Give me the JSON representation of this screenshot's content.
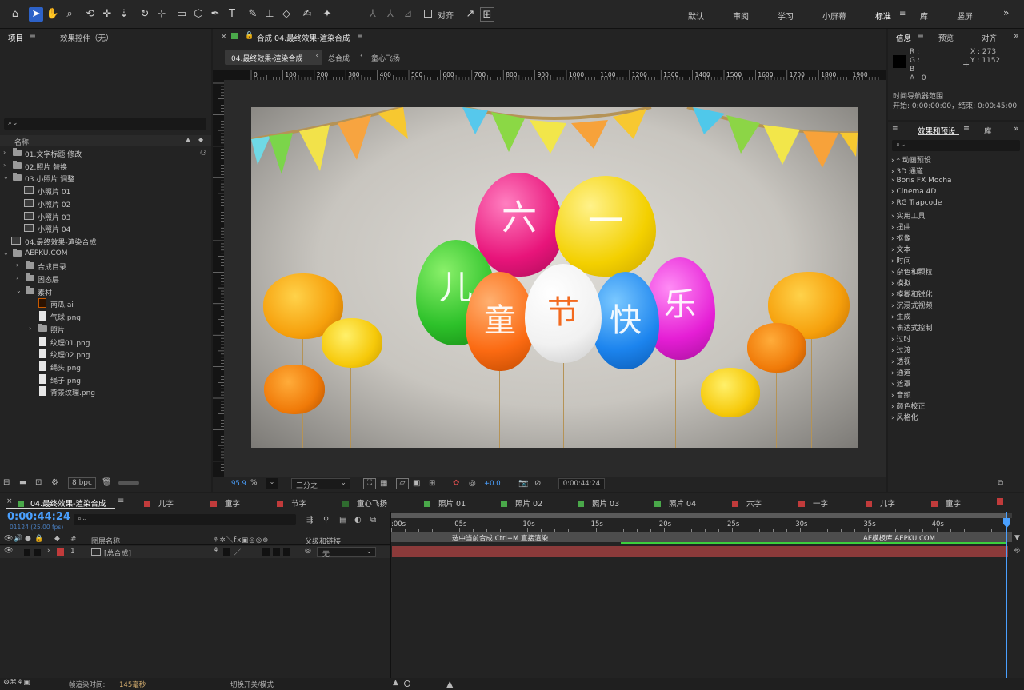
{
  "workspaces": [
    "默认",
    "审阅",
    "学习",
    "小屏幕",
    "标准",
    "库",
    "竖屏"
  ],
  "toolbar": {
    "align_label": "对齐"
  },
  "project_panel": {
    "tab_project": "项目",
    "tab_effects": "效果控件（无）",
    "search_placeholder": "",
    "col_name": "名称",
    "items": [
      {
        "label": "01.文字标题 修改",
        "level": 0,
        "type": "folder",
        "expanded": false
      },
      {
        "label": "02.照片 替换",
        "level": 0,
        "type": "folder",
        "expanded": false
      },
      {
        "label": "03.小照片 调整",
        "level": 0,
        "type": "folder",
        "expanded": true
      },
      {
        "label": "小照片 01",
        "level": 1,
        "type": "comp"
      },
      {
        "label": "小照片 02",
        "level": 1,
        "type": "comp"
      },
      {
        "label": "小照片 03",
        "level": 1,
        "type": "comp"
      },
      {
        "label": "小照片 04",
        "level": 1,
        "type": "comp"
      },
      {
        "label": "04.最终效果-渲染合成",
        "level": 0,
        "type": "comp"
      },
      {
        "label": "AEPKU.COM",
        "level": 0,
        "type": "folder",
        "expanded": true
      },
      {
        "label": "合成目录",
        "level": 1,
        "type": "folder",
        "expanded": false
      },
      {
        "label": "固态层",
        "level": 1,
        "type": "folder",
        "expanded": false
      },
      {
        "label": "素材",
        "level": 1,
        "type": "folder",
        "expanded": true
      },
      {
        "label": "南瓜.ai",
        "level": 2,
        "type": "ai"
      },
      {
        "label": "气球.png",
        "level": 2,
        "type": "file"
      },
      {
        "label": "照片",
        "level": 2,
        "type": "folder",
        "expanded": false
      },
      {
        "label": "纹理01.png",
        "level": 2,
        "type": "file"
      },
      {
        "label": "纹理02.png",
        "level": 2,
        "type": "file"
      },
      {
        "label": "绳头.png",
        "level": 2,
        "type": "file"
      },
      {
        "label": "绳子.png",
        "level": 2,
        "type": "file"
      },
      {
        "label": "背景纹理.png",
        "level": 2,
        "type": "file"
      }
    ],
    "bpc": "8 bpc"
  },
  "composition": {
    "header": "合成 04.最终效果-渲染合成",
    "breadcrumbs": [
      "04.最终效果-渲染合成",
      "总合成",
      "童心飞扬"
    ],
    "ruler_labels": [
      "0",
      "100",
      "200",
      "300",
      "400",
      "500",
      "600",
      "700",
      "800",
      "900",
      "1000",
      "1100",
      "1200",
      "1300",
      "1400",
      "1500",
      "1600",
      "1700",
      "1800",
      "1900"
    ],
    "zoom_value": "95.9",
    "zoom_unit": "%",
    "resolution": "三分之一",
    "exposure": "+0.0",
    "timecode": "0:00:44:24",
    "balloon_chars": [
      "六",
      "一",
      "儿",
      "童",
      "节",
      "快",
      "乐"
    ]
  },
  "info_panel": {
    "tabs": [
      "信息",
      "预览",
      "对齐"
    ],
    "r": "R :",
    "g": "G :",
    "b": "B :",
    "a": "A : 0",
    "x": "X : 273",
    "y": "Y : 1152",
    "nav_title": "时间导航器范围",
    "nav_range": "开始: 0:00:00:00，结束: 0:00:45:00"
  },
  "effects_panel": {
    "tab": "效果和预设",
    "tab_lib": "库",
    "items": [
      "* 动画预设",
      "3D 通道",
      "Boris FX Mocha",
      "Cinema 4D",
      "RG Trapcode",
      "实用工具",
      "扭曲",
      "抠像",
      "文本",
      "时间",
      "杂色和颗粒",
      "模拟",
      "模糊和锐化",
      "沉浸式视频",
      "生成",
      "表达式控制",
      "过时",
      "过渡",
      "透视",
      "通道",
      "遮罩",
      "音频",
      "颜色校正",
      "风格化"
    ]
  },
  "timeline": {
    "tabs": [
      {
        "label": "04.最终效果-渲染合成",
        "color": "#4aa84a"
      },
      {
        "label": "儿字",
        "color": "#c13b3b"
      },
      {
        "label": "童字",
        "color": "#c13b3b"
      },
      {
        "label": "节字",
        "color": "#c13b3b"
      },
      {
        "label": "童心飞扬",
        "color": "#2f6b2f"
      },
      {
        "label": "照片 01",
        "color": "#4aa84a"
      },
      {
        "label": "照片 02",
        "color": "#4aa84a"
      },
      {
        "label": "照片 03",
        "color": "#4aa84a"
      },
      {
        "label": "照片 04",
        "color": "#4aa84a"
      },
      {
        "label": "六字",
        "color": "#c13b3b"
      },
      {
        "label": "一字",
        "color": "#c13b3b"
      },
      {
        "label": "儿字",
        "color": "#c13b3b"
      },
      {
        "label": "童字",
        "color": "#c13b3b"
      }
    ],
    "timecode": "0:00:44:24",
    "frames": "01124 (25.00 fps)",
    "col_layer_name": "图层名称",
    "col_parent": "父级和链接",
    "col_num": "#",
    "layer": {
      "num": "1",
      "name": "[总合成]",
      "parent": "无"
    },
    "ruler_labels": [
      ":00s",
      "05s",
      "10s",
      "15s",
      "20s",
      "25s",
      "30s",
      "35s",
      "40s"
    ],
    "marker_1": "选中当前合成 Ctrl+M 直接渲染",
    "marker_2": "AE模板库 AEPKU.COM",
    "footer_label": "帧渲染时间:",
    "footer_value": "145毫秒",
    "footer_toggle": "切换开关/模式"
  },
  "colors": {
    "accent": "#2d62c8",
    "time_blue": "#4aa0ff",
    "layer_bar": "#8b3a3a"
  }
}
